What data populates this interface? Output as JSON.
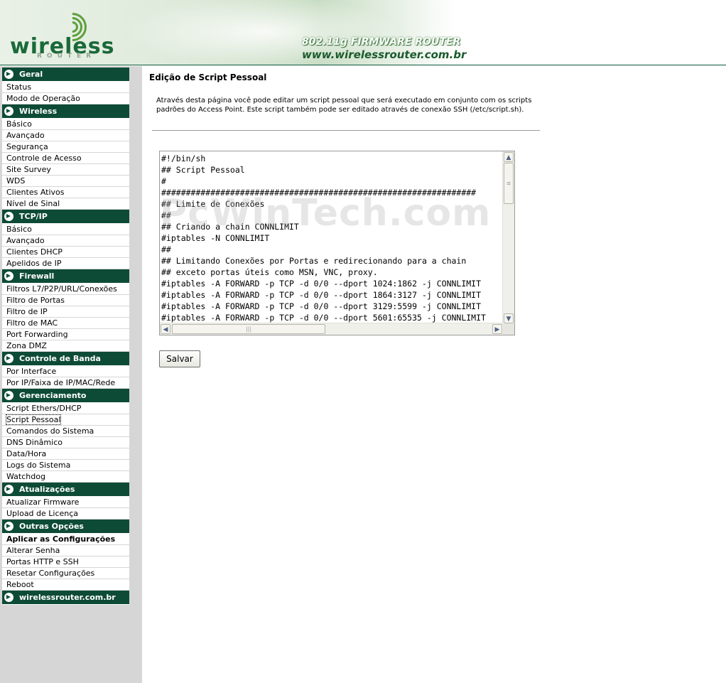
{
  "header": {
    "logo_text": "wireless",
    "logo_sub": "ROUTER",
    "firmware_text": "802.11g FIRMWARE ROUTER",
    "site_url": "www.wirelessrouter.com.br"
  },
  "sidebar": {
    "sections": [
      {
        "title": "Geral",
        "items": [
          "Status",
          "Modo de Operação"
        ]
      },
      {
        "title": "Wireless",
        "items": [
          "Básico",
          "Avançado",
          "Segurança",
          "Controle de Acesso",
          "Site Survey",
          "WDS",
          "Clientes Ativos",
          "Nível de Sinal"
        ]
      },
      {
        "title": "TCP/IP",
        "items": [
          "Básico",
          "Avançado",
          "Clientes DHCP",
          "Apelidos de IP"
        ]
      },
      {
        "title": "Firewall",
        "items": [
          "Filtros L7/P2P/URL/Conexões",
          "Filtro de Portas",
          "Filtro de IP",
          "Filtro de MAC",
          "Port Forwarding",
          "Zona DMZ"
        ]
      },
      {
        "title": "Controle de Banda",
        "items": [
          "Por Interface",
          "Por IP/Faixa de IP/MAC/Rede"
        ]
      },
      {
        "title": "Gerenciamento",
        "items": [
          "Script Ethers/DHCP",
          "Script Pessoal",
          "Comandos do Sistema",
          "DNS Dinâmico",
          "Data/Hora",
          "Logs do Sistema",
          "Watchdog"
        ]
      },
      {
        "title": "Atualizações",
        "items": [
          "Atualizar Firmware",
          "Upload de Licença"
        ]
      },
      {
        "title": "Outras Opções",
        "items": [
          "Aplicar as Configurações",
          "Alterar Senha",
          "Portas HTTP e SSH",
          "Resetar Configurações",
          "Reboot"
        ]
      },
      {
        "title": "wirelessrouter.com.br",
        "items": []
      }
    ],
    "current_item": "Script Pessoal",
    "bold_item": "Aplicar as Configurações"
  },
  "main": {
    "title": "Edição de Script Pessoal",
    "description": "Através desta página você pode editar um script pessoal que será executado em conjunto com os scripts padrões do Access Point. Este script também pode ser editado através de conexão SSH (/etc/script.sh).",
    "script_lines": [
      "#!/bin/sh",
      "## Script Pessoal",
      "#",
      "################################################################",
      "## Limite de Conexões",
      "##",
      "## Criando a chain CONNLIMIT",
      "#iptables -N CONNLIMIT",
      "##",
      "## Limitando Conexões por Portas e redirecionando para a chain",
      "## exceto portas úteis como MSN, VNC, proxy.",
      "#iptables -A FORWARD -p TCP -d 0/0 --dport 1024:1862 -j CONNLIMIT",
      "#iptables -A FORWARD -p TCP -d 0/0 --dport 1864:3127 -j CONNLIMIT",
      "#iptables -A FORWARD -p TCP -d 0/0 --dport 3129:5599 -j CONNLIMIT",
      "#iptables -A FORWARD -p TCP -d 0/0 --dport 5601:65535 -j CONNLIMIT"
    ],
    "save_label": "Salvar"
  },
  "watermark": "PcWinTech.com",
  "colors": {
    "section_header_bg": "#0d4b36",
    "sidebar_bg": "#d6d6d6",
    "header_line": "#0b5a3d"
  }
}
